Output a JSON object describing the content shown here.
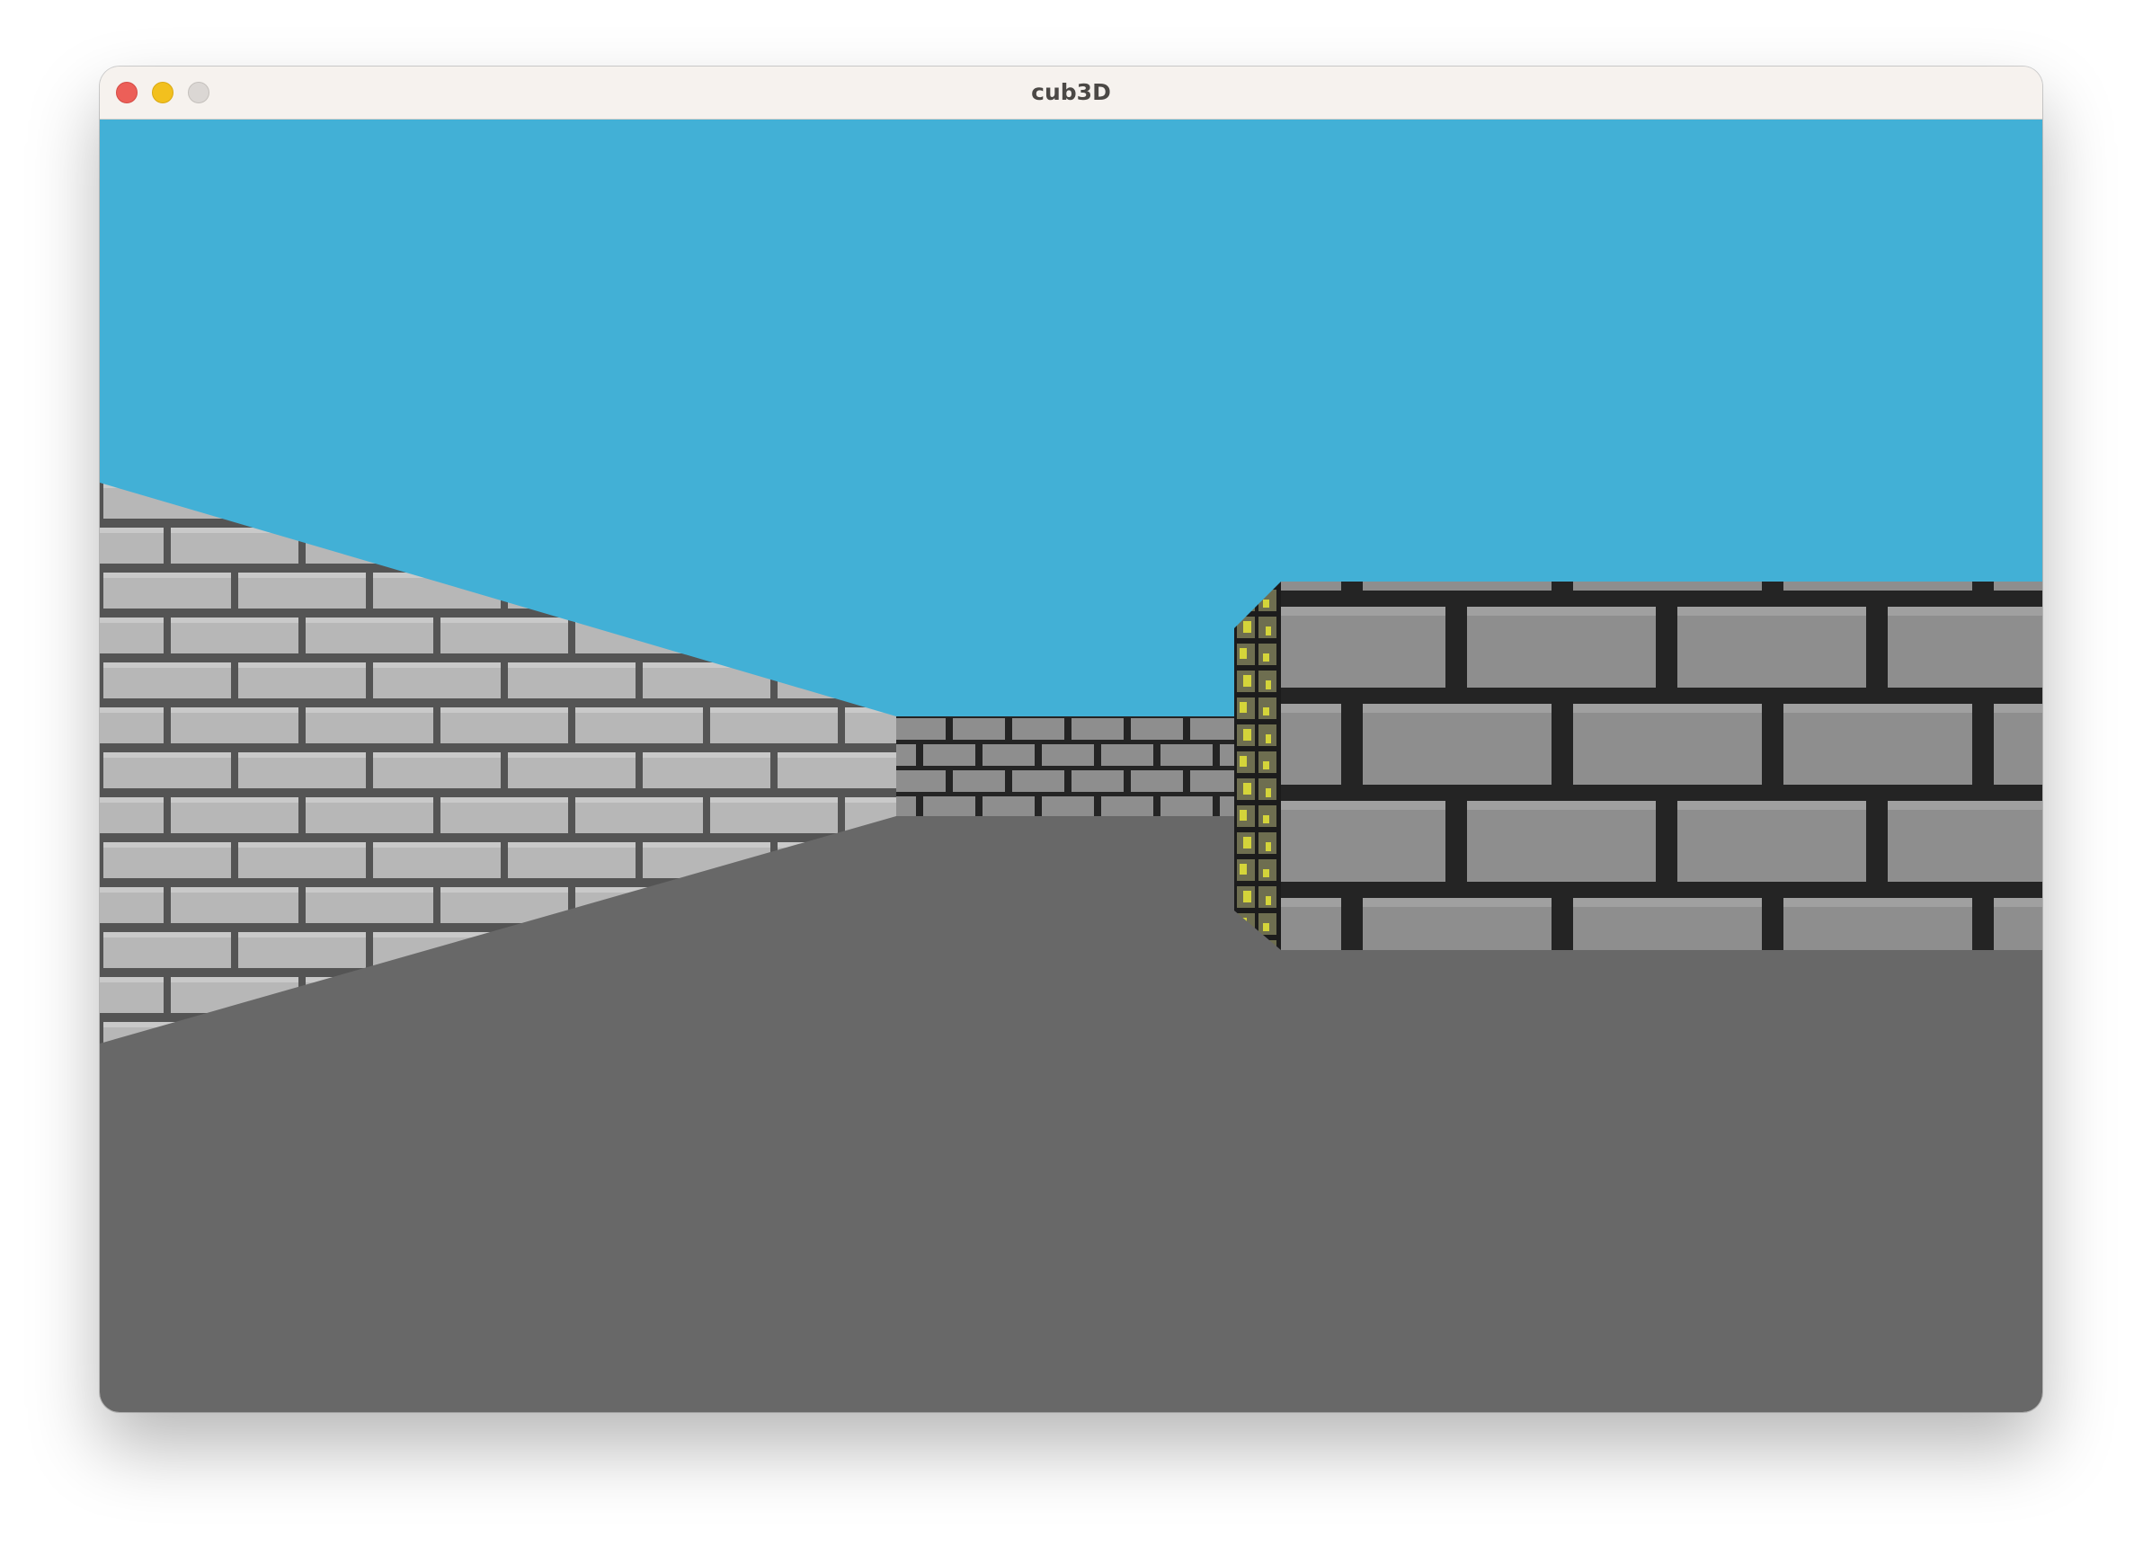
{
  "window": {
    "title": "cub3D",
    "traffic_lights": {
      "close": {
        "color": "#ec5f58",
        "border": "#d44c45"
      },
      "minimize": {
        "color": "#f2c01e",
        "border": "#d9a914"
      },
      "zoom": {
        "color": "#dbd7d4",
        "border": "#c4c0bc"
      }
    }
  },
  "scene": {
    "ceiling_color": "#42b0d6",
    "floor_color": "#686868",
    "textures": {
      "light_stone": {
        "brick": "#bfbfbf",
        "mortar": "#585858",
        "highlight": "#d2d2d2"
      },
      "dark_stone": {
        "brick": "#8e8e8e",
        "mortar": "#242424",
        "highlight": "#a0a0a0"
      },
      "mossy_stone": {
        "brick": "#6e6e50",
        "mortar": "#1c1c1c",
        "moss": "#d4d43a"
      }
    }
  }
}
